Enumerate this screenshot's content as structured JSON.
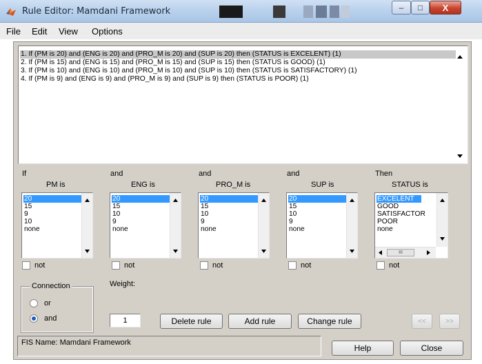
{
  "window": {
    "title": "Rule Editor: Mamdani Framework",
    "minimize": "–",
    "maximize": "□",
    "close": "X"
  },
  "menu": [
    "File",
    "Edit",
    "View",
    "Options"
  ],
  "rules": [
    "1. If (PM is 20) and (ENG is 20) and (PRO_M is 20) and (SUP is 20) then (STATUS is EXCELENT) (1)",
    "2. If (PM is 15) and (ENG is 15) and (PRO_M is 15) and (SUP is 15) then (STATUS is GOOD) (1)",
    "3. If (PM is 10) and (ENG is 10) and (PRO_M is 10) and (SUP is 10) then (STATUS is SATISFACTORY) (1)",
    "4. If (PM is 9) and (ENG is 9) and (PRO_M is 9) and (SUP is 9) then (STATUS is POOR) (1)"
  ],
  "variables": [
    {
      "connector": "If",
      "name": "PM is",
      "items": [
        "20",
        "15",
        "9",
        "10",
        "none"
      ],
      "not_label": "not"
    },
    {
      "connector": "and",
      "name": "ENG is",
      "items": [
        "20",
        "15",
        "10",
        "9",
        "none"
      ],
      "not_label": "not"
    },
    {
      "connector": "and",
      "name": "PRO_M is",
      "items": [
        "20",
        "15",
        "10",
        "9",
        "none"
      ],
      "not_label": "not"
    },
    {
      "connector": "and",
      "name": "SUP is",
      "items": [
        "20",
        "15",
        "10",
        "9",
        "none"
      ],
      "not_label": "not"
    },
    {
      "connector": "Then",
      "name": "STATUS is",
      "items": [
        "EXCELENT",
        "GOOD",
        "SATISFACTOR",
        "POOR",
        "none"
      ],
      "not_label": "not"
    }
  ],
  "connection": {
    "title": "Connection",
    "or_label": "or",
    "and_label": "and",
    "selected": "and"
  },
  "weight": {
    "label": "Weight:",
    "value": "1"
  },
  "buttons": {
    "delete": "Delete rule",
    "add": "Add rule",
    "change": "Change rule",
    "prev": "<<",
    "next": ">>",
    "help": "Help",
    "close": "Close"
  },
  "status_bar": "FIS Name: Mamdani Framework",
  "hscroll_label": "III"
}
